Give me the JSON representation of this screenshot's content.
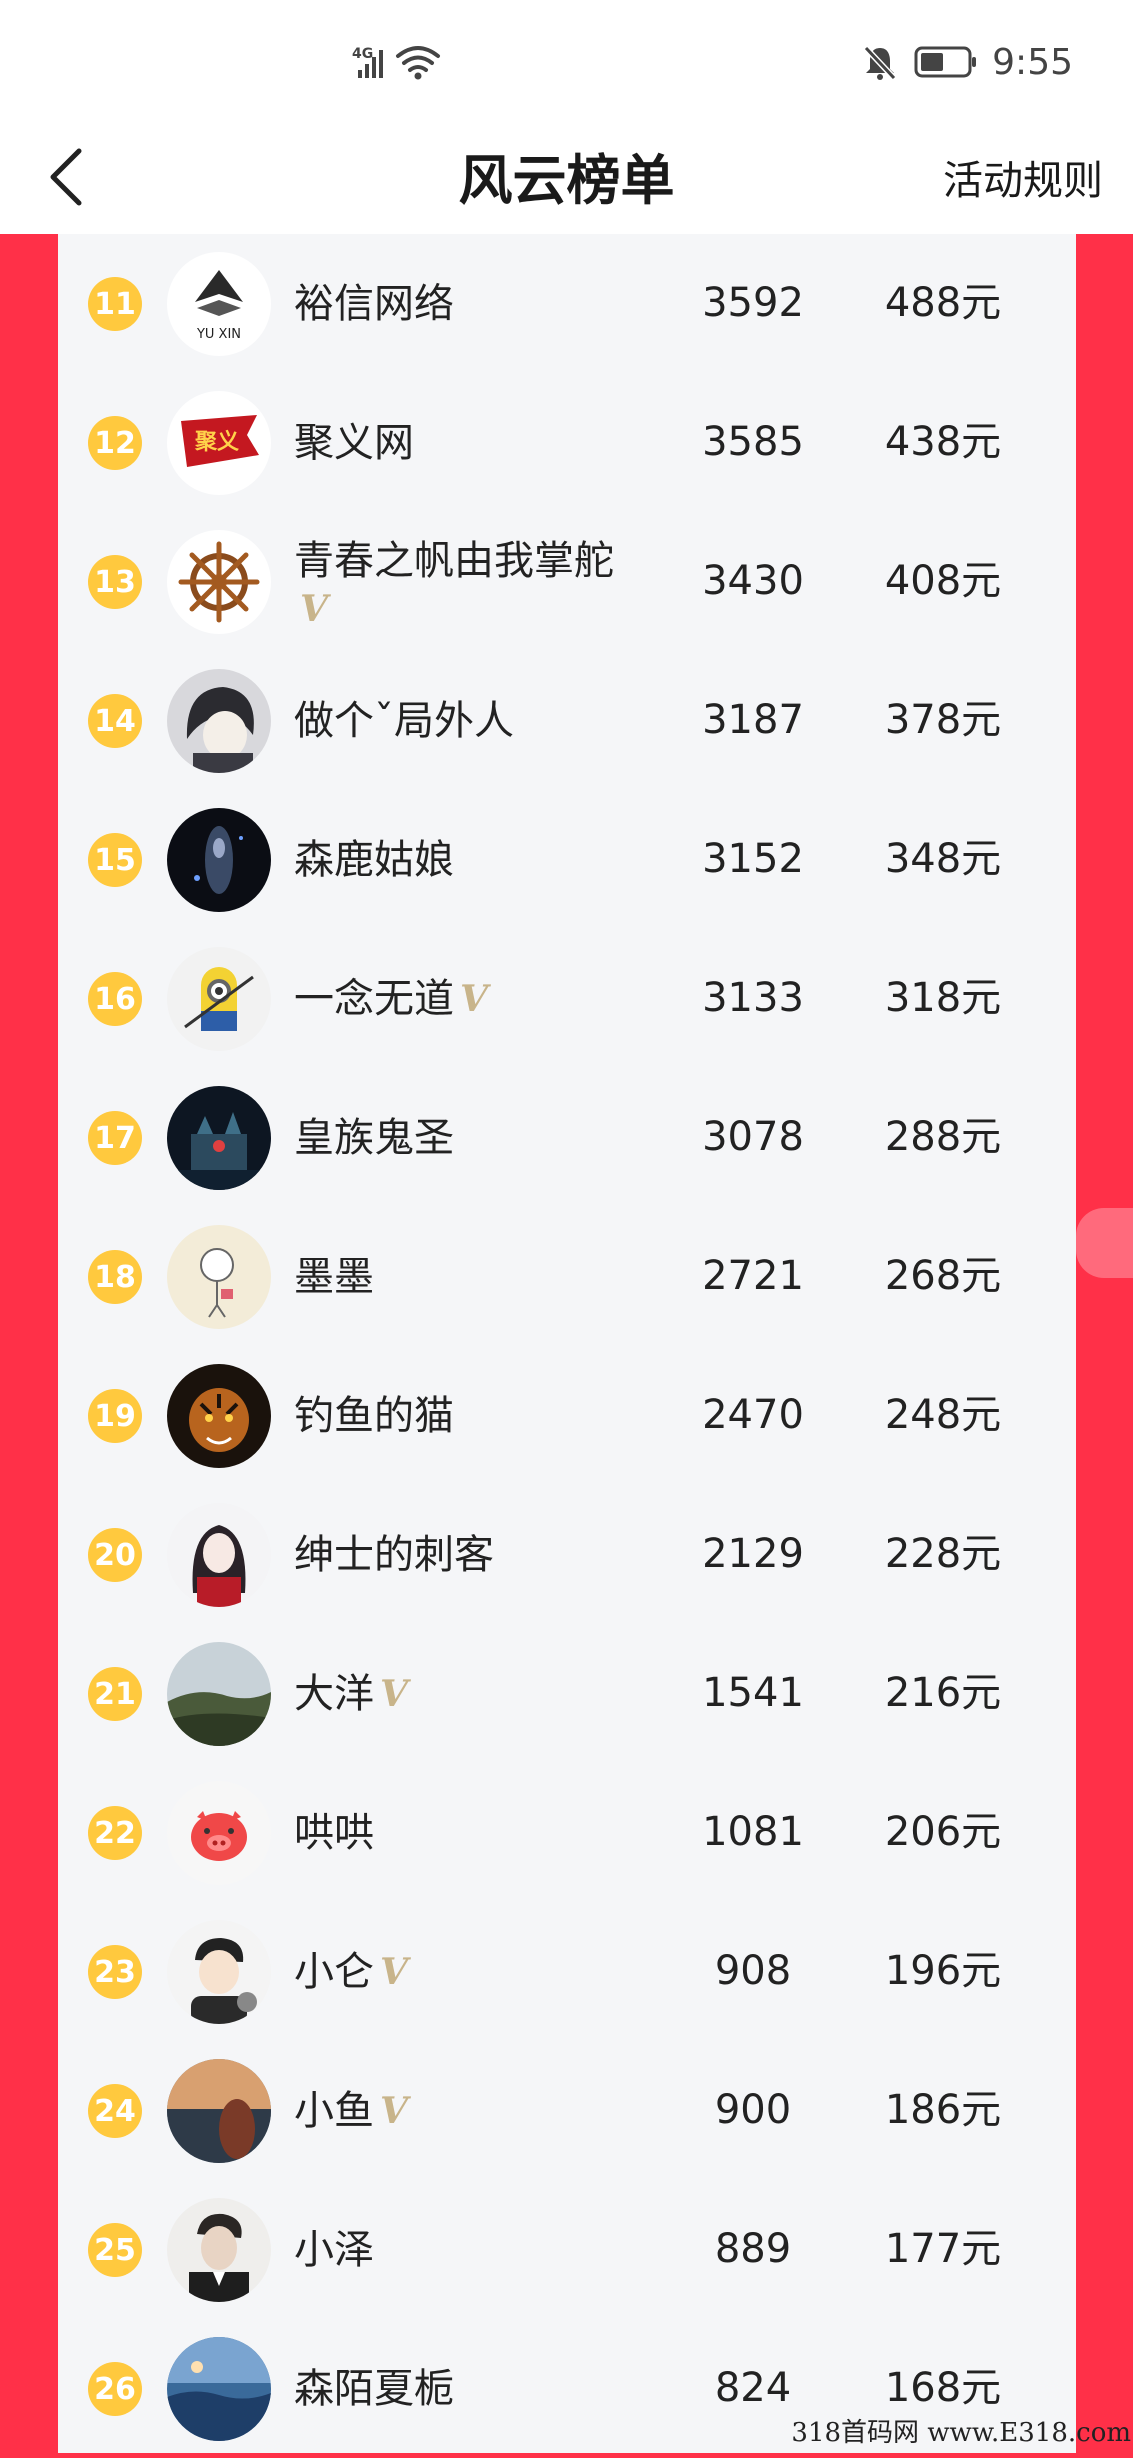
{
  "status_bar": {
    "network": "4G",
    "time": "9:55"
  },
  "header": {
    "title": "风云榜单",
    "rules_label": "活动规则"
  },
  "colors": {
    "background_red": "#ff3048",
    "badge_yellow": "#ffc93e",
    "verified_gold": "#c8b48a",
    "panel": "#f5f6f8"
  },
  "rows": [
    {
      "rank": "11",
      "name": "裕信网络",
      "verified": false,
      "score": "3592",
      "prize": "488元",
      "avatar_icon": "yuxin-logo-avatar"
    },
    {
      "rank": "12",
      "name": "聚义网",
      "verified": false,
      "score": "3585",
      "prize": "438元",
      "avatar_icon": "flag-avatar"
    },
    {
      "rank": "13",
      "name": "青春之帆由我掌舵",
      "verified": true,
      "score": "3430",
      "prize": "408元",
      "avatar_icon": "ship-wheel-avatar"
    },
    {
      "rank": "14",
      "name": "做个ˇ局外人",
      "verified": false,
      "score": "3187",
      "prize": "378元",
      "avatar_icon": "anime-boy-avatar"
    },
    {
      "rank": "15",
      "name": "森鹿姑娘",
      "verified": false,
      "score": "3152",
      "prize": "348元",
      "avatar_icon": "dark-figure-avatar"
    },
    {
      "rank": "16",
      "name": "一念无道",
      "verified": true,
      "score": "3133",
      "prize": "318元",
      "avatar_icon": "minion-avatar"
    },
    {
      "rank": "17",
      "name": "皇族鬼圣",
      "verified": false,
      "score": "3078",
      "prize": "288元",
      "avatar_icon": "castle-night-avatar"
    },
    {
      "rank": "18",
      "name": "墨墨",
      "verified": false,
      "score": "2721",
      "prize": "268元",
      "avatar_icon": "doodle-avatar"
    },
    {
      "rank": "19",
      "name": "钓鱼的猫",
      "verified": false,
      "score": "2470",
      "prize": "248元",
      "avatar_icon": "tiger-avatar"
    },
    {
      "rank": "20",
      "name": "绅士的刺客",
      "verified": false,
      "score": "2129",
      "prize": "228元",
      "avatar_icon": "anime-girl-avatar"
    },
    {
      "rank": "21",
      "name": "大洋",
      "verified": true,
      "score": "1541",
      "prize": "216元",
      "avatar_icon": "landscape-avatar"
    },
    {
      "rank": "22",
      "name": "哄哄",
      "verified": false,
      "score": "1081",
      "prize": "206元",
      "avatar_icon": "pig-avatar"
    },
    {
      "rank": "23",
      "name": "小仑",
      "verified": true,
      "score": "908",
      "prize": "196元",
      "avatar_icon": "cartoon-boy-avatar"
    },
    {
      "rank": "24",
      "name": "小鱼",
      "verified": true,
      "score": "900",
      "prize": "186元",
      "avatar_icon": "sunset-avatar"
    },
    {
      "rank": "25",
      "name": "小泽",
      "verified": false,
      "score": "889",
      "prize": "177元",
      "avatar_icon": "man-portrait-avatar"
    },
    {
      "rank": "26",
      "name": "森陌夏栀",
      "verified": false,
      "score": "824",
      "prize": "168元",
      "avatar_icon": "sea-avatar"
    }
  ],
  "watermark": "318首码网 www.E318.com"
}
